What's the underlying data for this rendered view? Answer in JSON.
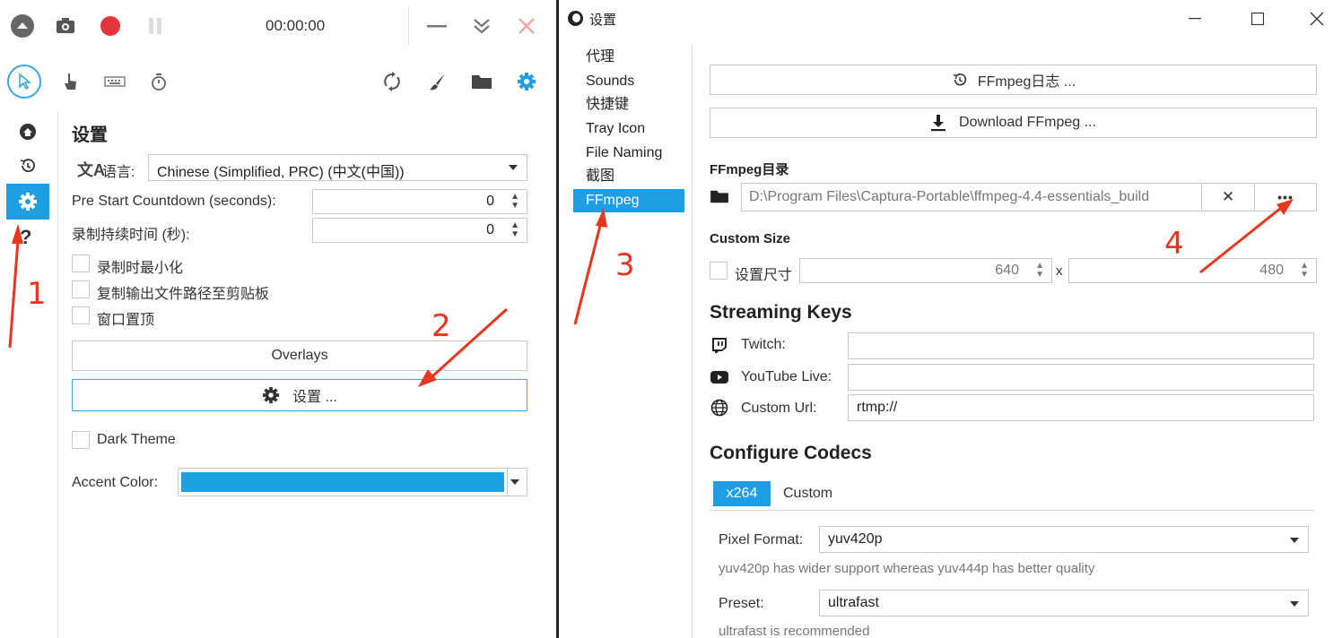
{
  "left_window": {
    "timer": "00:00:00",
    "side_nav": [
      "home-icon",
      "history-icon",
      "gear-icon",
      "help-icon"
    ],
    "help_label": "?",
    "settings_title": "设置",
    "language_label": "语言:",
    "language_value": "Chinese (Simplified, PRC) (中文(中国))",
    "countdown_label": "Pre Start Countdown (seconds):",
    "countdown_value": "0",
    "duration_label": "录制持续时间 (秒):",
    "duration_value": "0",
    "checkboxes": [
      "录制时最小化",
      "复制输出文件路径至剪贴板",
      "窗口置顶"
    ],
    "overlays_button": "Overlays",
    "settings_button": "设置 ...",
    "dark_theme_label": "Dark Theme",
    "accent_label": "Accent Color:",
    "accent_color": "#1ea1e3"
  },
  "right_window": {
    "title": "设置",
    "nav": [
      "代理",
      "Sounds",
      "快捷键",
      "Tray Icon",
      "File Naming",
      "截图",
      "FFmpeg"
    ],
    "ffmpeg_log_button": "FFmpeg日志 ...",
    "download_button": "Download FFmpeg ...",
    "ffmpeg_dir_label": "FFmpeg目录",
    "ffmpeg_dir_value": "D:\\Program Files\\Captura-Portable\\ffmpeg-4.4-essentials_build",
    "clear_button": "✕",
    "browse_button": "•••",
    "custom_size_label": "Custom Size",
    "set_size_label": "设置尺寸",
    "width_value": "640",
    "times_label": "x",
    "height_value": "480",
    "streaming_title": "Streaming Keys",
    "twitch_label": "Twitch:",
    "youtube_label": "YouTube Live:",
    "custom_url_label": "Custom Url:",
    "custom_url_value": "rtmp://",
    "codecs_title": "Configure Codecs",
    "codec_tabs": [
      "x264",
      "Custom"
    ],
    "pixel_format_label": "Pixel Format:",
    "pixel_format_value": "yuv420p",
    "pixel_format_hint": "yuv420p has wider support whereas yuv444p has better quality",
    "preset_label": "Preset:",
    "preset_value": "ultrafast",
    "preset_hint": "ultrafast is recommended"
  },
  "annotations": [
    "1",
    "2",
    "3",
    "4"
  ],
  "colors": {
    "accent": "#1ea1e3",
    "annotation": "#e8361e",
    "record": "#e2363b"
  }
}
